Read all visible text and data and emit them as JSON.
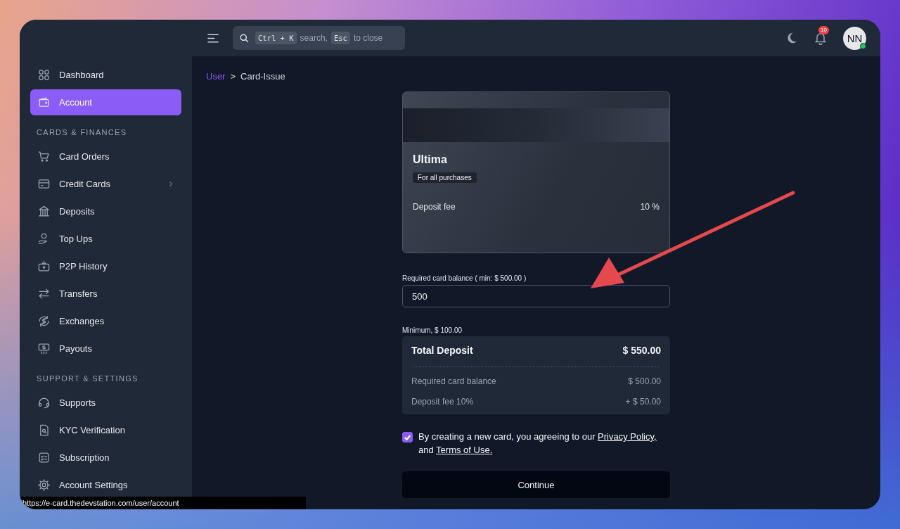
{
  "topbar": {
    "search": {
      "key_1": "Ctrl + K",
      "text_1": "search,",
      "key_2": "Esc",
      "text_2": "to close"
    },
    "notifications": {
      "count": "10"
    },
    "avatar": {
      "initials": "NN",
      "online": true
    }
  },
  "sidebar": {
    "sections": [
      {
        "items": [
          {
            "label": "Dashboard",
            "selected": false,
            "submenu": false
          },
          {
            "label": "Account",
            "selected": true,
            "submenu": false
          }
        ]
      },
      {
        "heading": "CARDS & FINANCES",
        "items": [
          {
            "label": "Card Orders",
            "selected": false,
            "submenu": false
          },
          {
            "label": "Credit Cards",
            "selected": false,
            "submenu": true
          },
          {
            "label": "Deposits",
            "selected": false,
            "submenu": false
          },
          {
            "label": "Top Ups",
            "selected": false,
            "submenu": false
          },
          {
            "label": "P2P History",
            "selected": false,
            "submenu": false
          },
          {
            "label": "Transfers",
            "selected": false,
            "submenu": false
          },
          {
            "label": "Exchanges",
            "selected": false,
            "submenu": false
          },
          {
            "label": "Payouts",
            "selected": false,
            "submenu": false
          }
        ]
      },
      {
        "heading": "SUPPORT & SETTINGS",
        "items": [
          {
            "label": "Supports",
            "selected": false,
            "submenu": false
          },
          {
            "label": "KYC Verification",
            "selected": false,
            "submenu": false
          },
          {
            "label": "Subscription",
            "selected": false,
            "submenu": false
          },
          {
            "label": "Account Settings",
            "selected": false,
            "submenu": false
          }
        ]
      }
    ]
  },
  "breadcrumb_separator": ">",
  "breadcrumb": [
    {
      "label": "User",
      "kind": "link"
    },
    {
      "label": "Card-Issue",
      "kind": "current"
    }
  ],
  "card": {
    "name": "Ultima",
    "tag": "For all purchases",
    "fee_label": "Deposit fee",
    "fee_value": "10 %"
  },
  "balance_field": {
    "label": "Required card balance ( min: $ 500.00 )",
    "value": "500",
    "hint": "Minimum, $ 100.00"
  },
  "summary": {
    "title": "Total Deposit",
    "total": "$ 550.00",
    "rows": [
      {
        "label": "Required card balance",
        "value": "$ 500.00"
      },
      {
        "label": "Deposit fee 10%",
        "value": "+ $ 50.00"
      }
    ]
  },
  "agreement": {
    "checked": true,
    "text": "By creating a new card, you agreeing to our",
    "link_1": "Privacy Policy,",
    "joiner": "and",
    "link_2": "Terms of Use."
  },
  "continue_button": "Continue",
  "status_bar": "https://e-card.thedevstation.com/user/account"
}
